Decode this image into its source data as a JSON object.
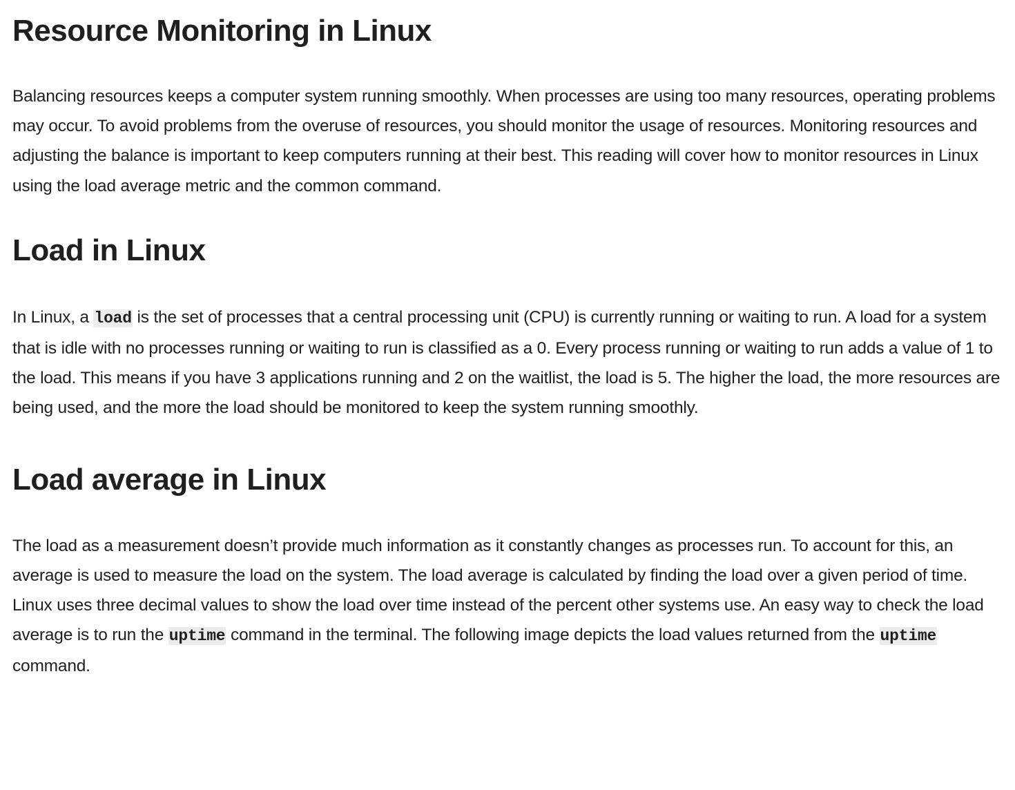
{
  "title": "Resource Monitoring in Linux",
  "intro": "Balancing resources keeps a computer system running smoothly. When processes are using too many resources, operating problems may occur. To avoid problems from the overuse of resources, you should monitor the usage of resources. Monitoring resources and adjusting the balance is important to keep computers running at their best. This reading will cover how to monitor resources in Linux using the load average metric and the common command.",
  "section_load": {
    "heading": "Load in Linux",
    "text_before": "In Linux, a ",
    "code": "load",
    "text_after": " is the set of processes that a central processing unit (CPU) is currently running or waiting to run. A load for a system that is idle with no processes running or waiting to run is classified as a 0. Every process running or waiting to run adds a value of 1 to the load. This means if you have 3 applications running and 2 on the waitlist, the load is 5. The higher the load, the more resources are being used, and the more the load should be monitored to keep the system running smoothly."
  },
  "section_load_average": {
    "heading": "Load average in Linux",
    "text_1": "The load as a measurement doesn’t provide much information as it constantly changes as processes run. To account for this, an average is used to measure the load on the system. The load average is calculated by finding the load over a given period of time. Linux uses three decimal values to show the load over time instead of the percent other systems use. An easy way to check the load average is to run the ",
    "code_1": "uptime",
    "text_2": " command in the terminal. The following image depicts the load values returned from the ",
    "code_2": "uptime",
    "text_3": " command."
  }
}
